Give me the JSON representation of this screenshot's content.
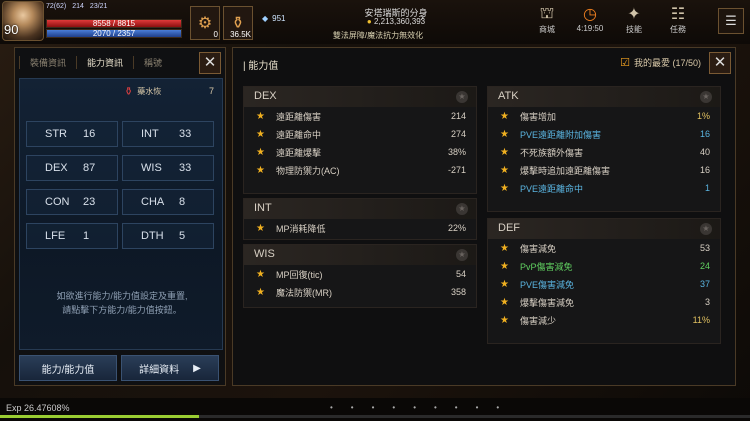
{
  "hud": {
    "level": "90",
    "top_stats": [
      "72(62)",
      "214",
      "23/21"
    ],
    "hp": "8558 / 8815",
    "mp": "2070 / 2357",
    "potion1_count": "0",
    "potion2_label": "36.5K",
    "gem_count": "951",
    "location_top": "安塔瑞斯的分身",
    "coin_value": "2,213,360,393",
    "location_bottom": "雙法屏障/魔法抗力無效化",
    "icons": [
      {
        "name": "shop-icon",
        "label": "商城"
      },
      {
        "name": "clock-icon",
        "label": "4:19:50"
      },
      {
        "name": "skill-icon",
        "label": "技能"
      },
      {
        "name": "quest-icon",
        "label": "任務"
      }
    ]
  },
  "left": {
    "tabs": [
      "裝備資訊",
      "能力資訊",
      "稱號"
    ],
    "potion_label": "藥水恢",
    "potion_value": "7",
    "stats": [
      {
        "k": "STR",
        "v": "16"
      },
      {
        "k": "INT",
        "v": "33"
      },
      {
        "k": "DEX",
        "v": "87"
      },
      {
        "k": "WIS",
        "v": "33"
      },
      {
        "k": "CON",
        "v": "23"
      },
      {
        "k": "CHA",
        "v": "8"
      },
      {
        "k": "LFE",
        "v": "1"
      },
      {
        "k": "DTH",
        "v": "5"
      }
    ],
    "hint": "如欲進行能力/能力值設定及重置,\n請點擊下方能力/能力值按鈕。",
    "btn_ability": "能力/能力值",
    "btn_detail": "詳細資料"
  },
  "right": {
    "title": "能力值",
    "fav_label": "我的最愛 (17/50)",
    "dex": {
      "title": "DEX",
      "rows": [
        {
          "n": "遠距離傷害",
          "v": "214"
        },
        {
          "n": "遠距離命中",
          "v": "274"
        },
        {
          "n": "遠距離爆擊",
          "v": "38%"
        },
        {
          "n": "物理防禦力(AC)",
          "v": "-271"
        }
      ]
    },
    "int": {
      "title": "INT",
      "rows": [
        {
          "n": "MP消耗降低",
          "v": "22%"
        }
      ]
    },
    "wis": {
      "title": "WIS",
      "rows": [
        {
          "n": "MP回復(tic)",
          "v": "54"
        },
        {
          "n": "魔法防禦(MR)",
          "v": "358"
        }
      ]
    },
    "atk": {
      "title": "ATK",
      "rows": [
        {
          "n": "傷害增加",
          "v": "1%",
          "c": ""
        },
        {
          "n": "PVE遠距離附加傷害",
          "v": "16",
          "c": "blue"
        },
        {
          "n": "不死族額外傷害",
          "v": "40",
          "c": ""
        },
        {
          "n": "爆擊時追加遠距離傷害",
          "v": "16",
          "c": ""
        },
        {
          "n": "PVE遠距離命中",
          "v": "1",
          "c": "blue"
        }
      ]
    },
    "def": {
      "title": "DEF",
      "rows": [
        {
          "n": "傷害減免",
          "v": "53",
          "c": ""
        },
        {
          "n": "PvP傷害減免",
          "v": "24",
          "c": "green"
        },
        {
          "n": "PVE傷害減免",
          "v": "37",
          "c": "blue"
        },
        {
          "n": "爆擊傷害減免",
          "v": "3",
          "c": ""
        },
        {
          "n": "傷害減少",
          "v": "11%",
          "c": ""
        }
      ]
    }
  },
  "bottom": {
    "exp": "Exp 26.47608%",
    "exp_fraction": 0.265
  }
}
